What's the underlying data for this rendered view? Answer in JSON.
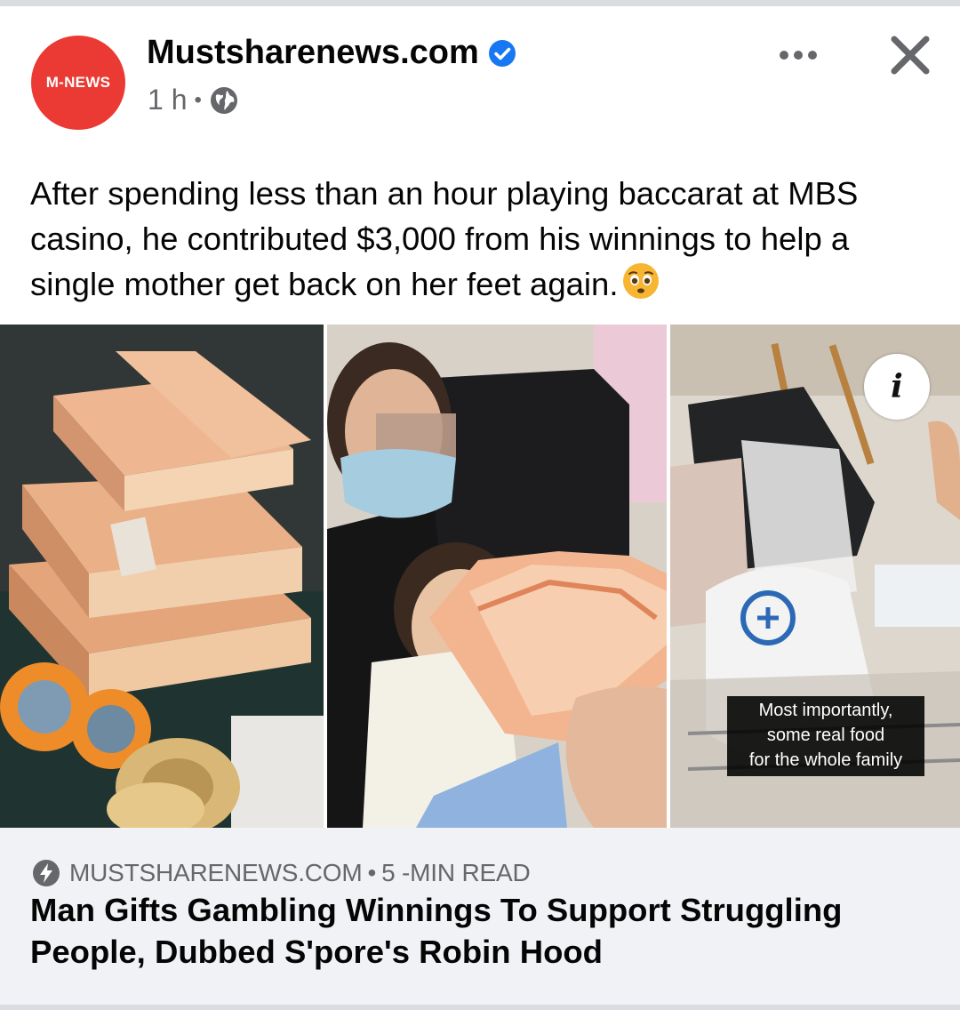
{
  "post": {
    "page_name": "Mustsharenews.com",
    "avatar_text": "M-NEWS",
    "time": "1 h",
    "separator": "•",
    "caption": "After spending less than an hour playing baccarat at MBS casino, he contributed $3,000 from his winnings to help a single mother get back on her feet again."
  },
  "media": {
    "overlay_text_lines": [
      "Most importantly,",
      "some real food",
      "for the whole family"
    ],
    "info_label": "i"
  },
  "link": {
    "domain": "MUSTSHARENEWS.COM",
    "separator": "•",
    "read_time": "5 -MIN READ",
    "title": "Man Gifts Gambling Winnings To Support Struggling People, Dubbed S'pore's Robin Hood"
  },
  "colors": {
    "brand_red": "#ea3a33",
    "verified_blue": "#1877f2",
    "secondary_text": "#65676b",
    "link_bg": "#f0f2f5"
  },
  "icons": [
    "verified-badge-icon",
    "globe-icon",
    "more-icon",
    "close-icon",
    "sad-face-emoji-icon",
    "info-icon",
    "lightning-bolt-icon"
  ]
}
